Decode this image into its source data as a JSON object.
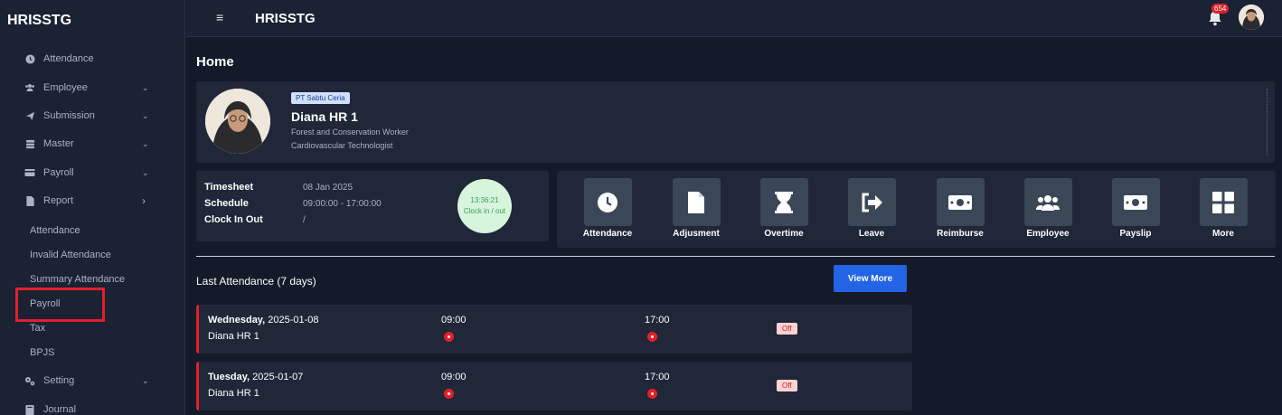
{
  "app": {
    "brand": "HRISSTG",
    "topbar_title": "HRISSTG",
    "notification_count": "654"
  },
  "sidebar": {
    "items": [
      {
        "label": "Attendance",
        "icon": "clock-icon"
      },
      {
        "label": "Employee",
        "icon": "users-icon"
      },
      {
        "label": "Submission",
        "icon": "send-icon"
      },
      {
        "label": "Master",
        "icon": "database-icon"
      },
      {
        "label": "Payroll",
        "icon": "card-icon"
      },
      {
        "label": "Report",
        "icon": "file-icon"
      }
    ],
    "report_sub": [
      "Attendance",
      "Invalid Attendance",
      "Summary Attendance",
      "Payroll",
      "Tax",
      "BPJS"
    ],
    "bottom_items": [
      {
        "label": "Setting",
        "icon": "gears-icon"
      },
      {
        "label": "Journal",
        "icon": "book-icon"
      }
    ]
  },
  "page": {
    "title": "Home"
  },
  "profile": {
    "company": "PT Sabtu Ceria",
    "name": "Diana HR 1",
    "position1": "Forest and Conservation Worker",
    "position2": "Cardiovascular Technologist"
  },
  "timesheet": {
    "timesheet_label": "Timesheet",
    "timesheet_value": "08 Jan 2025",
    "schedule_label": "Schedule",
    "schedule_value": "09:00:00 - 17:00:00",
    "clock_label": "Clock In Out",
    "clock_value": "/",
    "clock_time": "13:36:21",
    "clock_action": "Clock in / out"
  },
  "actions": [
    "Attendance",
    "Adjusment",
    "Overtime",
    "Leave",
    "Reimburse",
    "Employee",
    "Payslip",
    "More"
  ],
  "last_attendance": {
    "title": "Last Attendance (7 days)",
    "view_more": "View More",
    "rows": [
      {
        "day": "Wednesday,",
        "date": " 2025-01-08",
        "name": "Diana HR 1",
        "in": "09:00",
        "out": "17:00",
        "status": "Off"
      },
      {
        "day": "Tuesday,",
        "date": " 2025-01-07",
        "name": "Diana HR 1",
        "in": "09:00",
        "out": "17:00",
        "status": "Off"
      }
    ]
  },
  "colors": {
    "accent": "#2264e5",
    "danger": "#e3202a",
    "bg": "#141a29",
    "card": "#1f2738"
  }
}
